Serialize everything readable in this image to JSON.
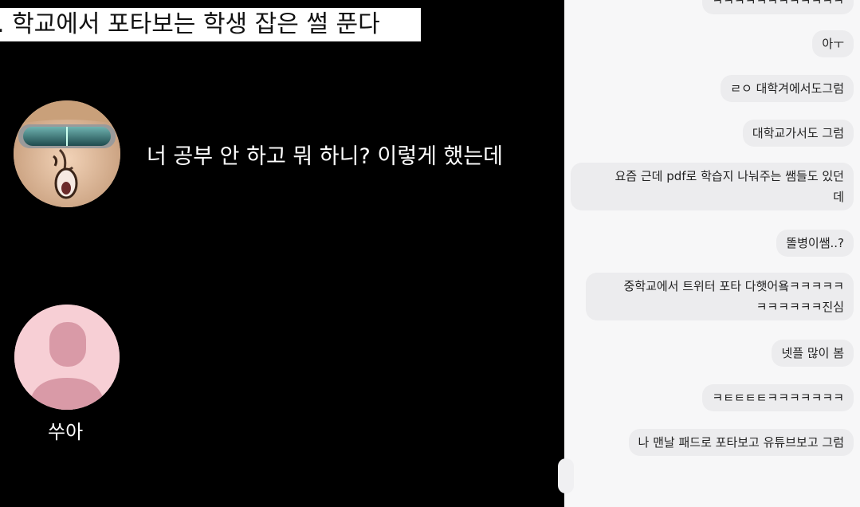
{
  "video": {
    "title": ". 학교에서 포타보는 학생 잡은 썰 푼다",
    "speech_line": "너 공부 안 하고 뭐 하니? 이렇게 했는데",
    "speaker_name": "쑤아"
  },
  "chat": {
    "messages": [
      {
        "text": "ㅋㅋㅋㅋㅋㅋㅋㅋㅋㅋㅋㅋ"
      },
      {
        "text": "아ㅜ"
      },
      {
        "text": "ㄹㅇ 대학겨에서도그럼"
      },
      {
        "text": "대학교가서도 그럼"
      },
      {
        "text": "요즘 근데 pdf로 학습지 나눠주는 쌤들도 있던\n데"
      },
      {
        "text": "똘병이쌤..?"
      },
      {
        "text": "중학교에서 트위터 포타 다햇어욬ㅋㅋㅋㅋㅋ\nㅋㅋㅋㅋㅋㅋ진심"
      },
      {
        "text": "넷플 많이 봄"
      },
      {
        "text": "ㅋㅌㅌㅌㅌㅋㅋㅋㅋㅋㅋㅋ"
      },
      {
        "text": "나 맨날 패드로 포타보고 유튜브보고 그럼"
      }
    ]
  },
  "colors": {
    "stage_bg": "#000000",
    "chat_bg": "#f7f7f8",
    "bubble_bg": "#ececee",
    "avatar_pink": "#f7cfd5"
  },
  "icons": {
    "avatar_1": "cartoon-face-with-visor-icon",
    "avatar_2": "default-user-silhouette-icon"
  }
}
